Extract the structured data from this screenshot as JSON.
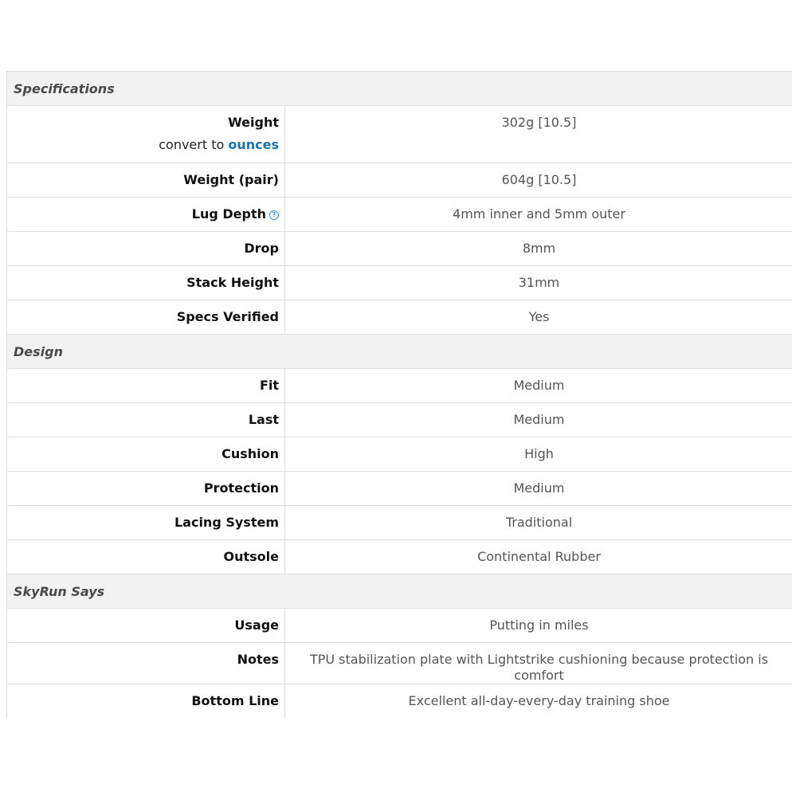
{
  "sections": [
    {
      "title": "Specifications",
      "rows": [
        {
          "label": "Weight",
          "value": "302g [10.5]",
          "convert_prefix": "convert to ",
          "convert_link": "ounces"
        },
        {
          "label": "Weight (pair)",
          "value": "604g [10.5]"
        },
        {
          "label": "Lug Depth",
          "value": "4mm inner and 5mm outer",
          "help_icon": "?"
        },
        {
          "label": "Drop",
          "value": "8mm"
        },
        {
          "label": "Stack Height",
          "value": "31mm"
        },
        {
          "label": "Specs Verified",
          "value": "Yes"
        }
      ]
    },
    {
      "title": "Design",
      "rows": [
        {
          "label": "Fit",
          "value": "Medium"
        },
        {
          "label": "Last",
          "value": "Medium"
        },
        {
          "label": "Cushion",
          "value": "High"
        },
        {
          "label": "Protection",
          "value": "Medium"
        },
        {
          "label": "Lacing System",
          "value": "Traditional"
        },
        {
          "label": "Outsole",
          "value": "Continental Rubber"
        }
      ]
    },
    {
      "title": "SkyRun Says",
      "rows": [
        {
          "label": "Usage",
          "value": "Putting in miles"
        },
        {
          "label": "Notes",
          "value": "TPU stabilization plate with Lightstrike cushioning because protection is comfort"
        },
        {
          "label": "Bottom Line",
          "value": "Excellent all-day-every-day training shoe"
        }
      ]
    }
  ],
  "colors": {
    "header_bg": "#f2f2f2",
    "border": "#dddddd",
    "link": "#1a73a8",
    "help_icon": "#3b8ecf"
  }
}
